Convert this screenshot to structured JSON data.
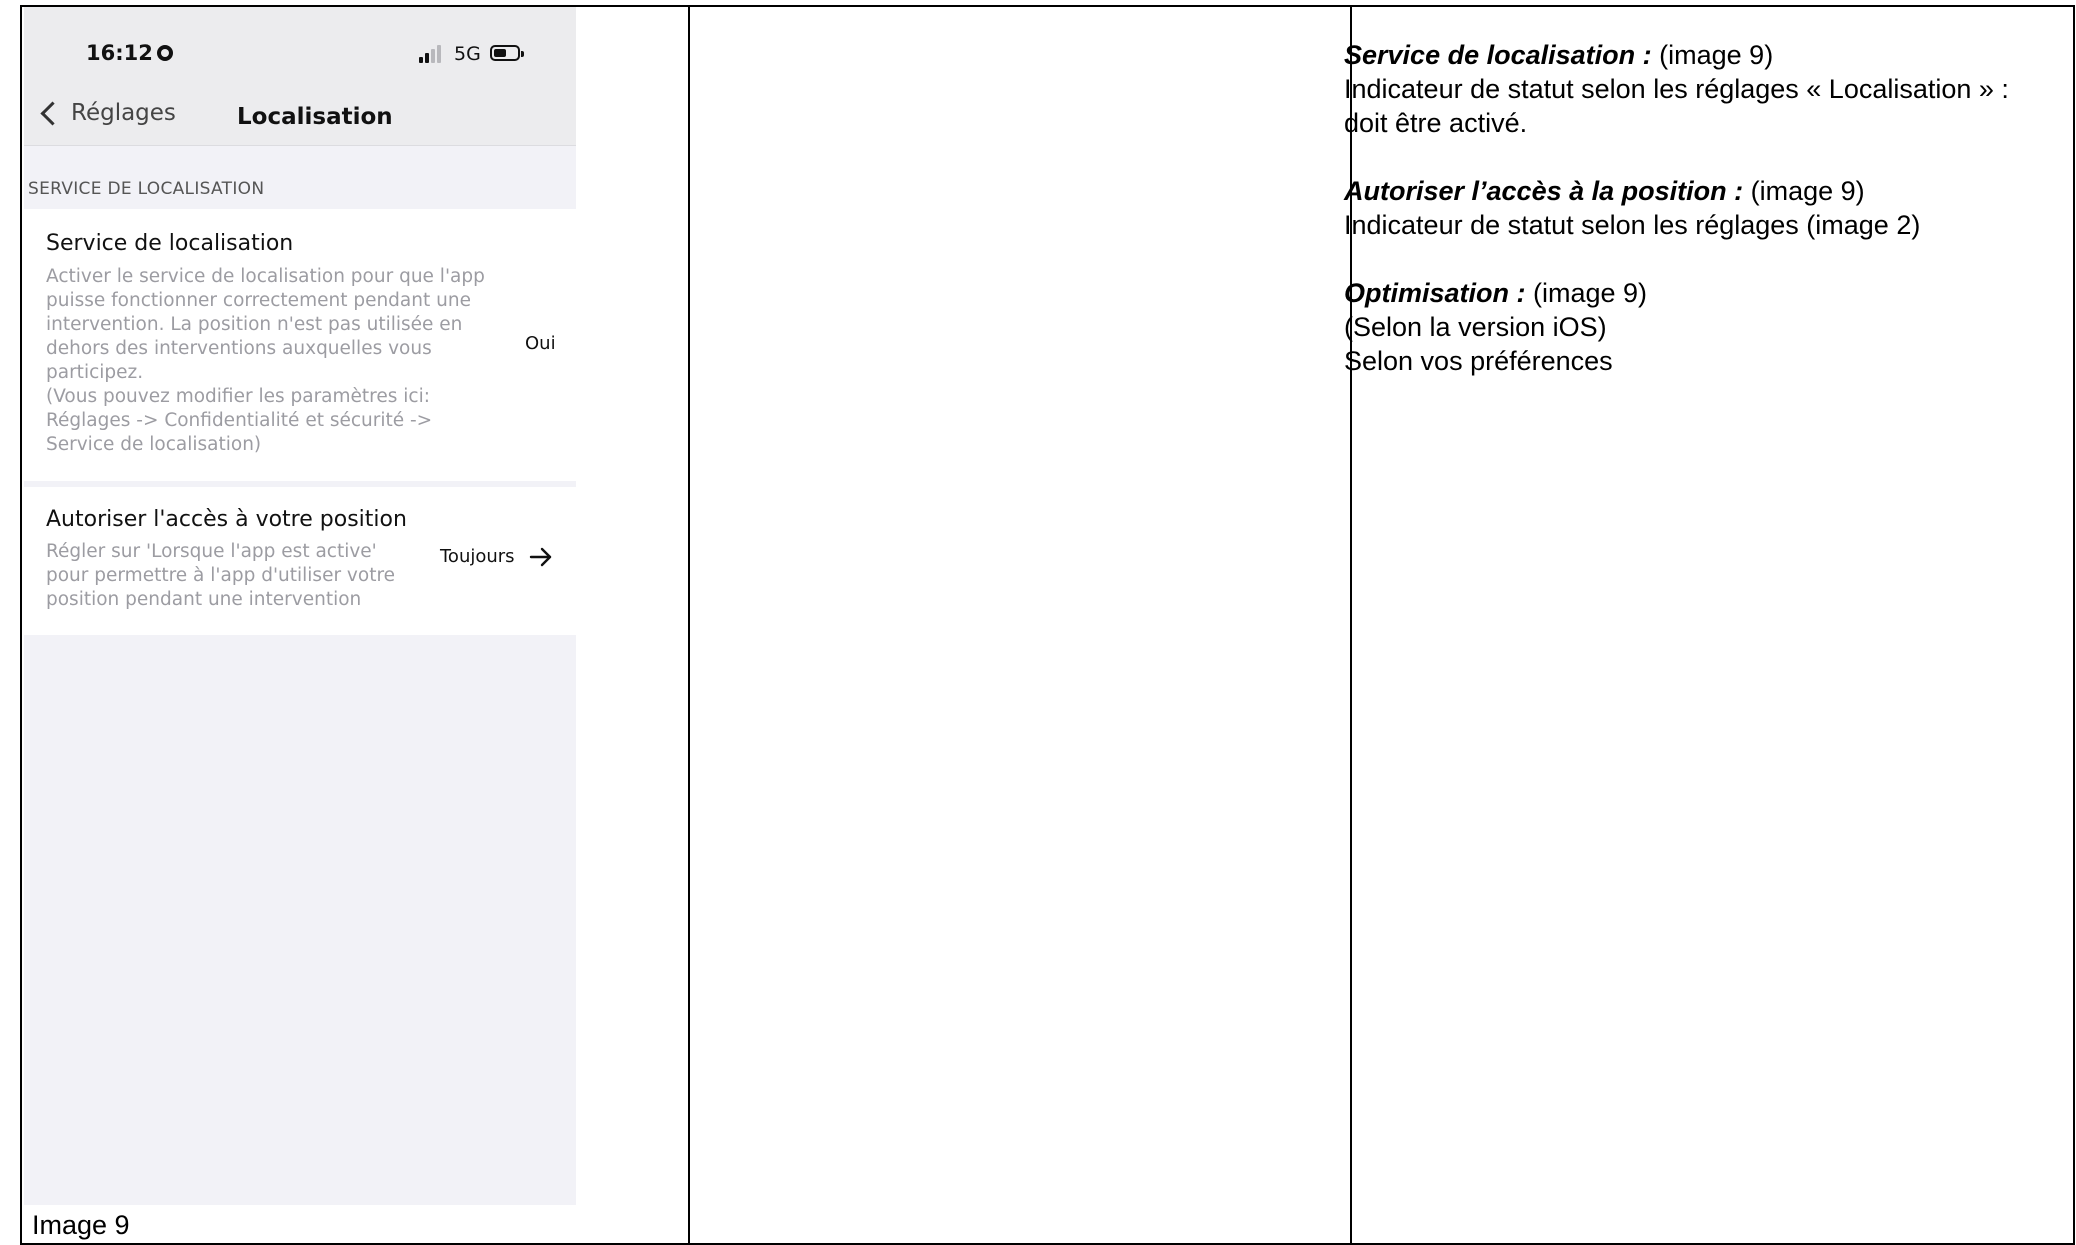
{
  "phone": {
    "status_time": "16:12",
    "network": "5G",
    "back_label": "Réglages",
    "nav_title": "Localisation",
    "section_header": "SERVICE DE LOCALISATION",
    "items": [
      {
        "title": "Service de localisation",
        "description": "Activer le service de localisation pour que l'app\npuisse fonctionner correctement pendant une\nintervention. La position n'est pas utilisée en\ndehors des interventions auxquelles vous\nparticipez.\n(Vous pouvez modifier les paramètres ici:\nRéglages -> Confidentialité et sécurité ->\nService de localisation)",
        "value": "Oui"
      },
      {
        "title": "Autoriser l'accès à votre position",
        "description": "Régler sur 'Lorsque l'app est active'\npour permettre à l'app d'utiliser votre\nposition pendant une intervention",
        "value": "Toujours"
      }
    ]
  },
  "caption": "Image 9",
  "notes": [
    {
      "title": "Service de localisation :",
      "ref": " (image 9)",
      "lines": [
        "Indicateur de statut selon les réglages « Localisation » : doit être activé."
      ]
    },
    {
      "title": "Autoriser l’accès à la position :",
      "ref": " (image 9)",
      "lines": [
        "Indicateur de statut selon les réglages (image 2)"
      ]
    },
    {
      "title": "Optimisation :",
      "ref": " (image 9)",
      "lines": [
        "(Selon la version iOS)",
        "Selon vos préférences"
      ]
    }
  ]
}
